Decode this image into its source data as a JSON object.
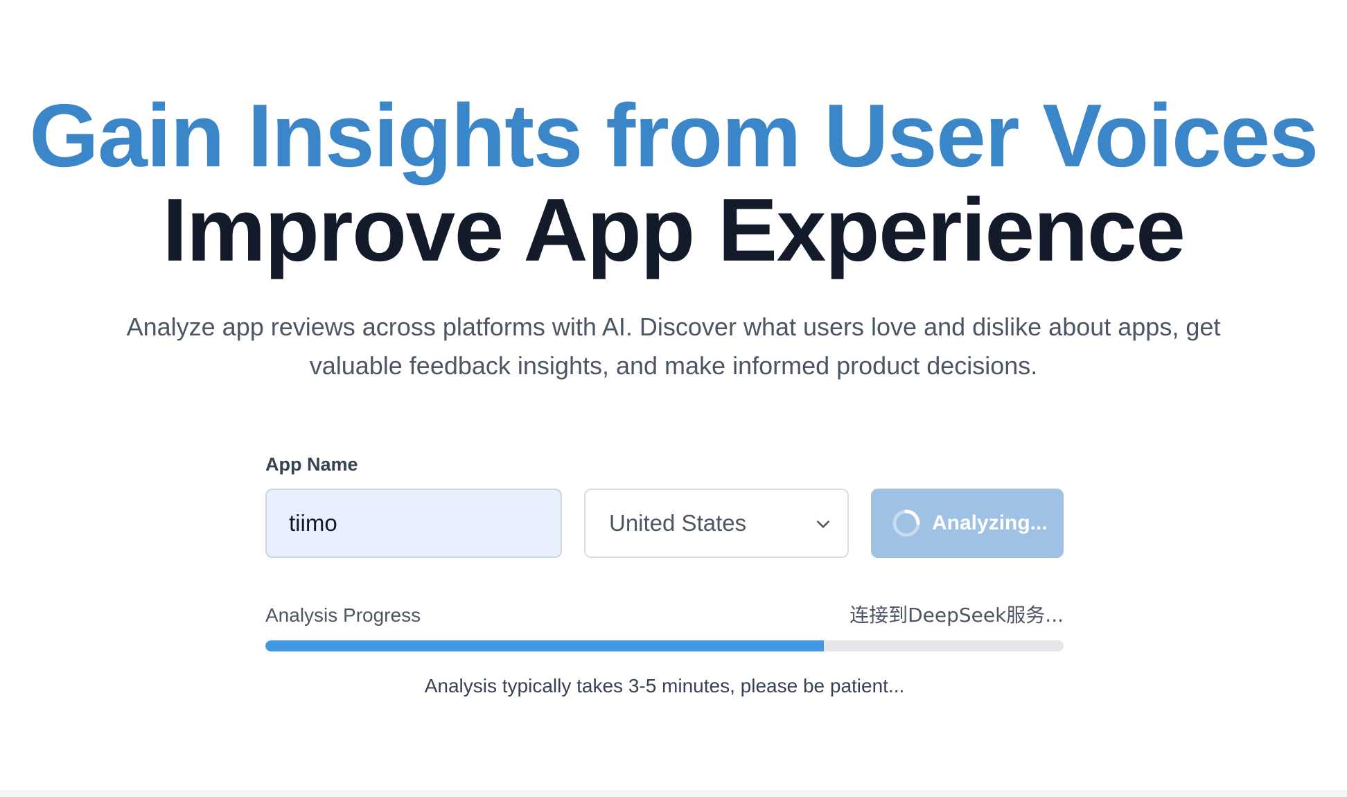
{
  "hero": {
    "title_line1": "Gain Insights from User Voices",
    "title_line2": "Improve App Experience",
    "subtitle_line1": "Analyze app reviews across platforms with AI. Discover what users love and dislike about apps, get",
    "subtitle_line2": "valuable feedback insights, and make informed product decisions."
  },
  "form": {
    "app_name_label": "App Name",
    "app_name_value": "tiimo",
    "country": {
      "selected": "United States",
      "icon": "chevron-down-icon"
    },
    "analyze_button": {
      "label": "Analyzing...",
      "icon": "spinner-icon",
      "disabled": true
    }
  },
  "progress": {
    "title": "Analysis Progress",
    "status": "连接到DeepSeek服务...",
    "fraction": 0.7,
    "note": "Analysis typically takes 3-5 minutes, please be patient..."
  },
  "colors": {
    "accent": "#3a86c8",
    "heading_dark": "#131a2a",
    "input_bg": "#e8f0fe",
    "button_disabled": "#9fc2e4",
    "progress_fill": "#4299e1",
    "progress_track": "#e5e7eb"
  }
}
